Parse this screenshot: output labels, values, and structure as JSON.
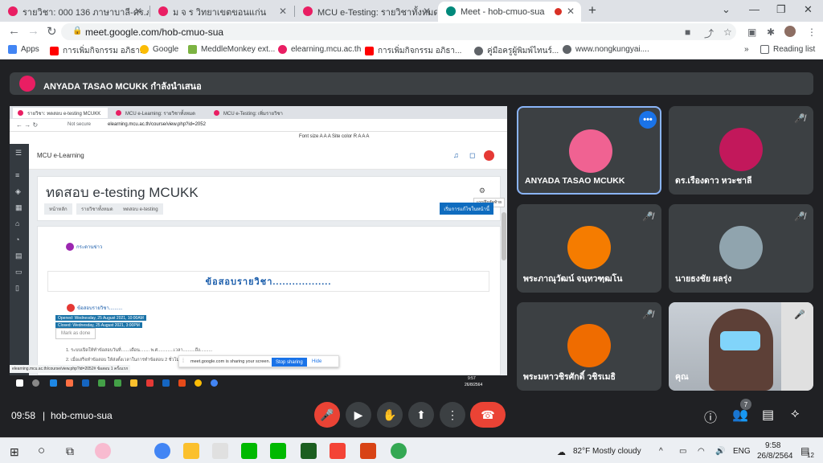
{
  "browser": {
    "tabs": [
      {
        "label": "รายวิชา: 000 136 ภาษาบาลี-ดร.ภูริพ",
        "color": "#e91e63"
      },
      {
        "label": "ม จ ร วิทยาเขตขอนแก่น",
        "color": "#e91e63"
      },
      {
        "label": "MCU e-Testing: รายวิชาทั้งหมด",
        "color": "#e91e63"
      },
      {
        "label": "Meet - hob-cmuo-sua",
        "color": "#00897b"
      }
    ],
    "url": "meet.google.com/hob-cmuo-sua",
    "bookmarks": [
      "Apps",
      "การเพิ่มกิจกรรม อภิธา...",
      "Google",
      "MeddleMonkey ext...",
      "elearning.mcu.ac.th",
      "การเพิ่มกิจกรรม อภิธา...",
      "คู่มือครูผู้พิมพ์ไทนร์...",
      "www.nongkungyai....",
      "Reading list"
    ]
  },
  "meet": {
    "presenting_banner": "ANYADA TASAO MCUKK กำลังนำเสนอ",
    "time": "09:58",
    "separator": "|",
    "meeting_code": "hob-cmuo-sua",
    "participant_count": "7",
    "participants": [
      {
        "name": "ANYADA TASAO MCUKK",
        "avatar_color": "#f06292"
      },
      {
        "name": "ดร.เรืองดาว หวะชาลี",
        "avatar_color": "#c2185b"
      },
      {
        "name": "พระภาณุวัฒน์ จนฺทวฑฺฒโน",
        "avatar_color": "#f57c00"
      },
      {
        "name": "นายธงชัย ผลรุ่ง",
        "avatar_color": "#90a4ae"
      },
      {
        "name": "พระมหาวชิรศักดิ์ วชิรเมธิ",
        "avatar_color": "#ef6c00"
      },
      {
        "name": "คุณ",
        "avatar_color": "#455a64"
      }
    ]
  },
  "shared_screen": {
    "tabs": [
      "รายวิชา: ทดสอบ e-testing MCUKK",
      "MCU e-Learning: รายวิชาทั้งหมด",
      "MCU e-Testing: เพิ่มรายวิชา"
    ],
    "not_secure": "Not secure",
    "url": "elearning.mcu.ac.th/course/view.php?id=2052",
    "font_toolbar": "Font size  A  A  A  Site color  R  A  A  A",
    "site_name": "MCU e-Learning",
    "course_title": "ทดสอบ e-testing MCUKK",
    "breadcrumbs": [
      "หน้าหลัก",
      "รายวิชาทั้งหมด",
      "ทดสอบ e-testing"
    ],
    "edit_button": "เริ่มการแก้ไขในหน้านี้",
    "tooltip": "แบบฝึกหัดท้าย",
    "forum": "กระดานข่าว",
    "section_heading": "ข้อสอบรายวิชา..................",
    "quiz": "ข้อสอบรายวิชา..........",
    "opened": "Opened: Wednesday, 25 August 2021, 10:00AM",
    "closed": "Closed: Wednesday, 25 August 2021, 3:00PM",
    "mark_done": "Mark as done",
    "line1": "1. ระบบเปิดให้ทำข้อสอบวันที่.......เดือน........ พ.ศ.............เวลา..........ถึง..........",
    "line2": "2. เมื่อเสร็จทำข้อสอบ ให้ส่งตั้งเวลาในการทำข้อสอบ 2 ชั่วโมง",
    "share_text": "meet.google.com is sharing your screen.",
    "stop_sharing": "Stop sharing",
    "hide": "Hide",
    "status_url": "elearning.mcu.ac.th/course/view.php?id=2052#  ข้อสอบ 1 ครั้งแรก",
    "task_time": "9:57",
    "task_date": "26/8/2564"
  },
  "taskbar": {
    "weather": "82°F  Mostly cloudy",
    "lang": "ENG",
    "time": "9:58",
    "date": "26/8/2564",
    "notif": "12"
  }
}
